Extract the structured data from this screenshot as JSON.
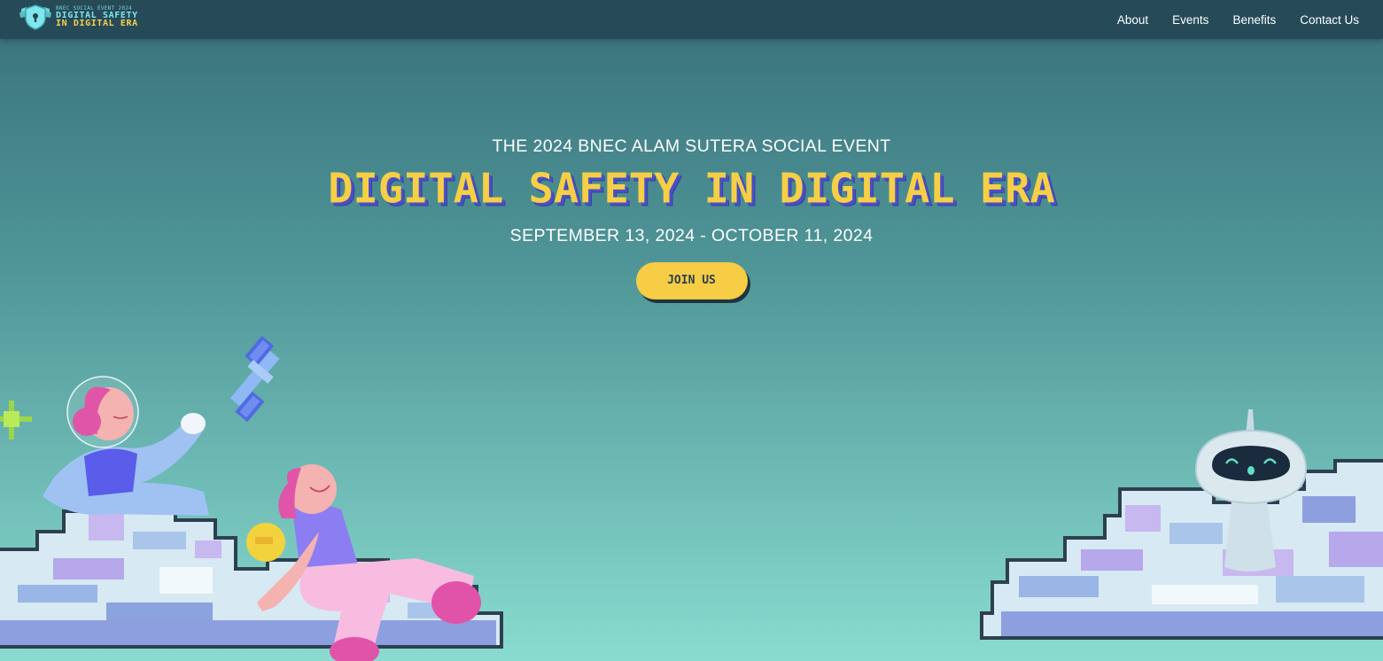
{
  "nav": {
    "logo": {
      "small_text": "BNEC SOCIAL EVENT 2024",
      "line1": "DIGITAL SAFETY",
      "line2": "IN DIGITAL ERA",
      "icon": "shield-lock-icon"
    },
    "links": [
      "About",
      "Events",
      "Benefits",
      "Contact Us"
    ]
  },
  "hero": {
    "subtitle": "THE 2024 BNEC ALAM SUTERA SOCIAL EVENT",
    "title": "DIGITAL SAFETY IN DIGITAL ERA",
    "dates": "SEPTEMBER 13, 2024 - OCTOBER 11, 2024",
    "cta_label": "JOIN US"
  },
  "colors": {
    "nav_bg": "#264a58",
    "accent_yellow": "#f6cd44",
    "title_shadow": "#4a4fc4",
    "bg_top": "#3a6d78",
    "bg_bottom": "#89dccf"
  }
}
